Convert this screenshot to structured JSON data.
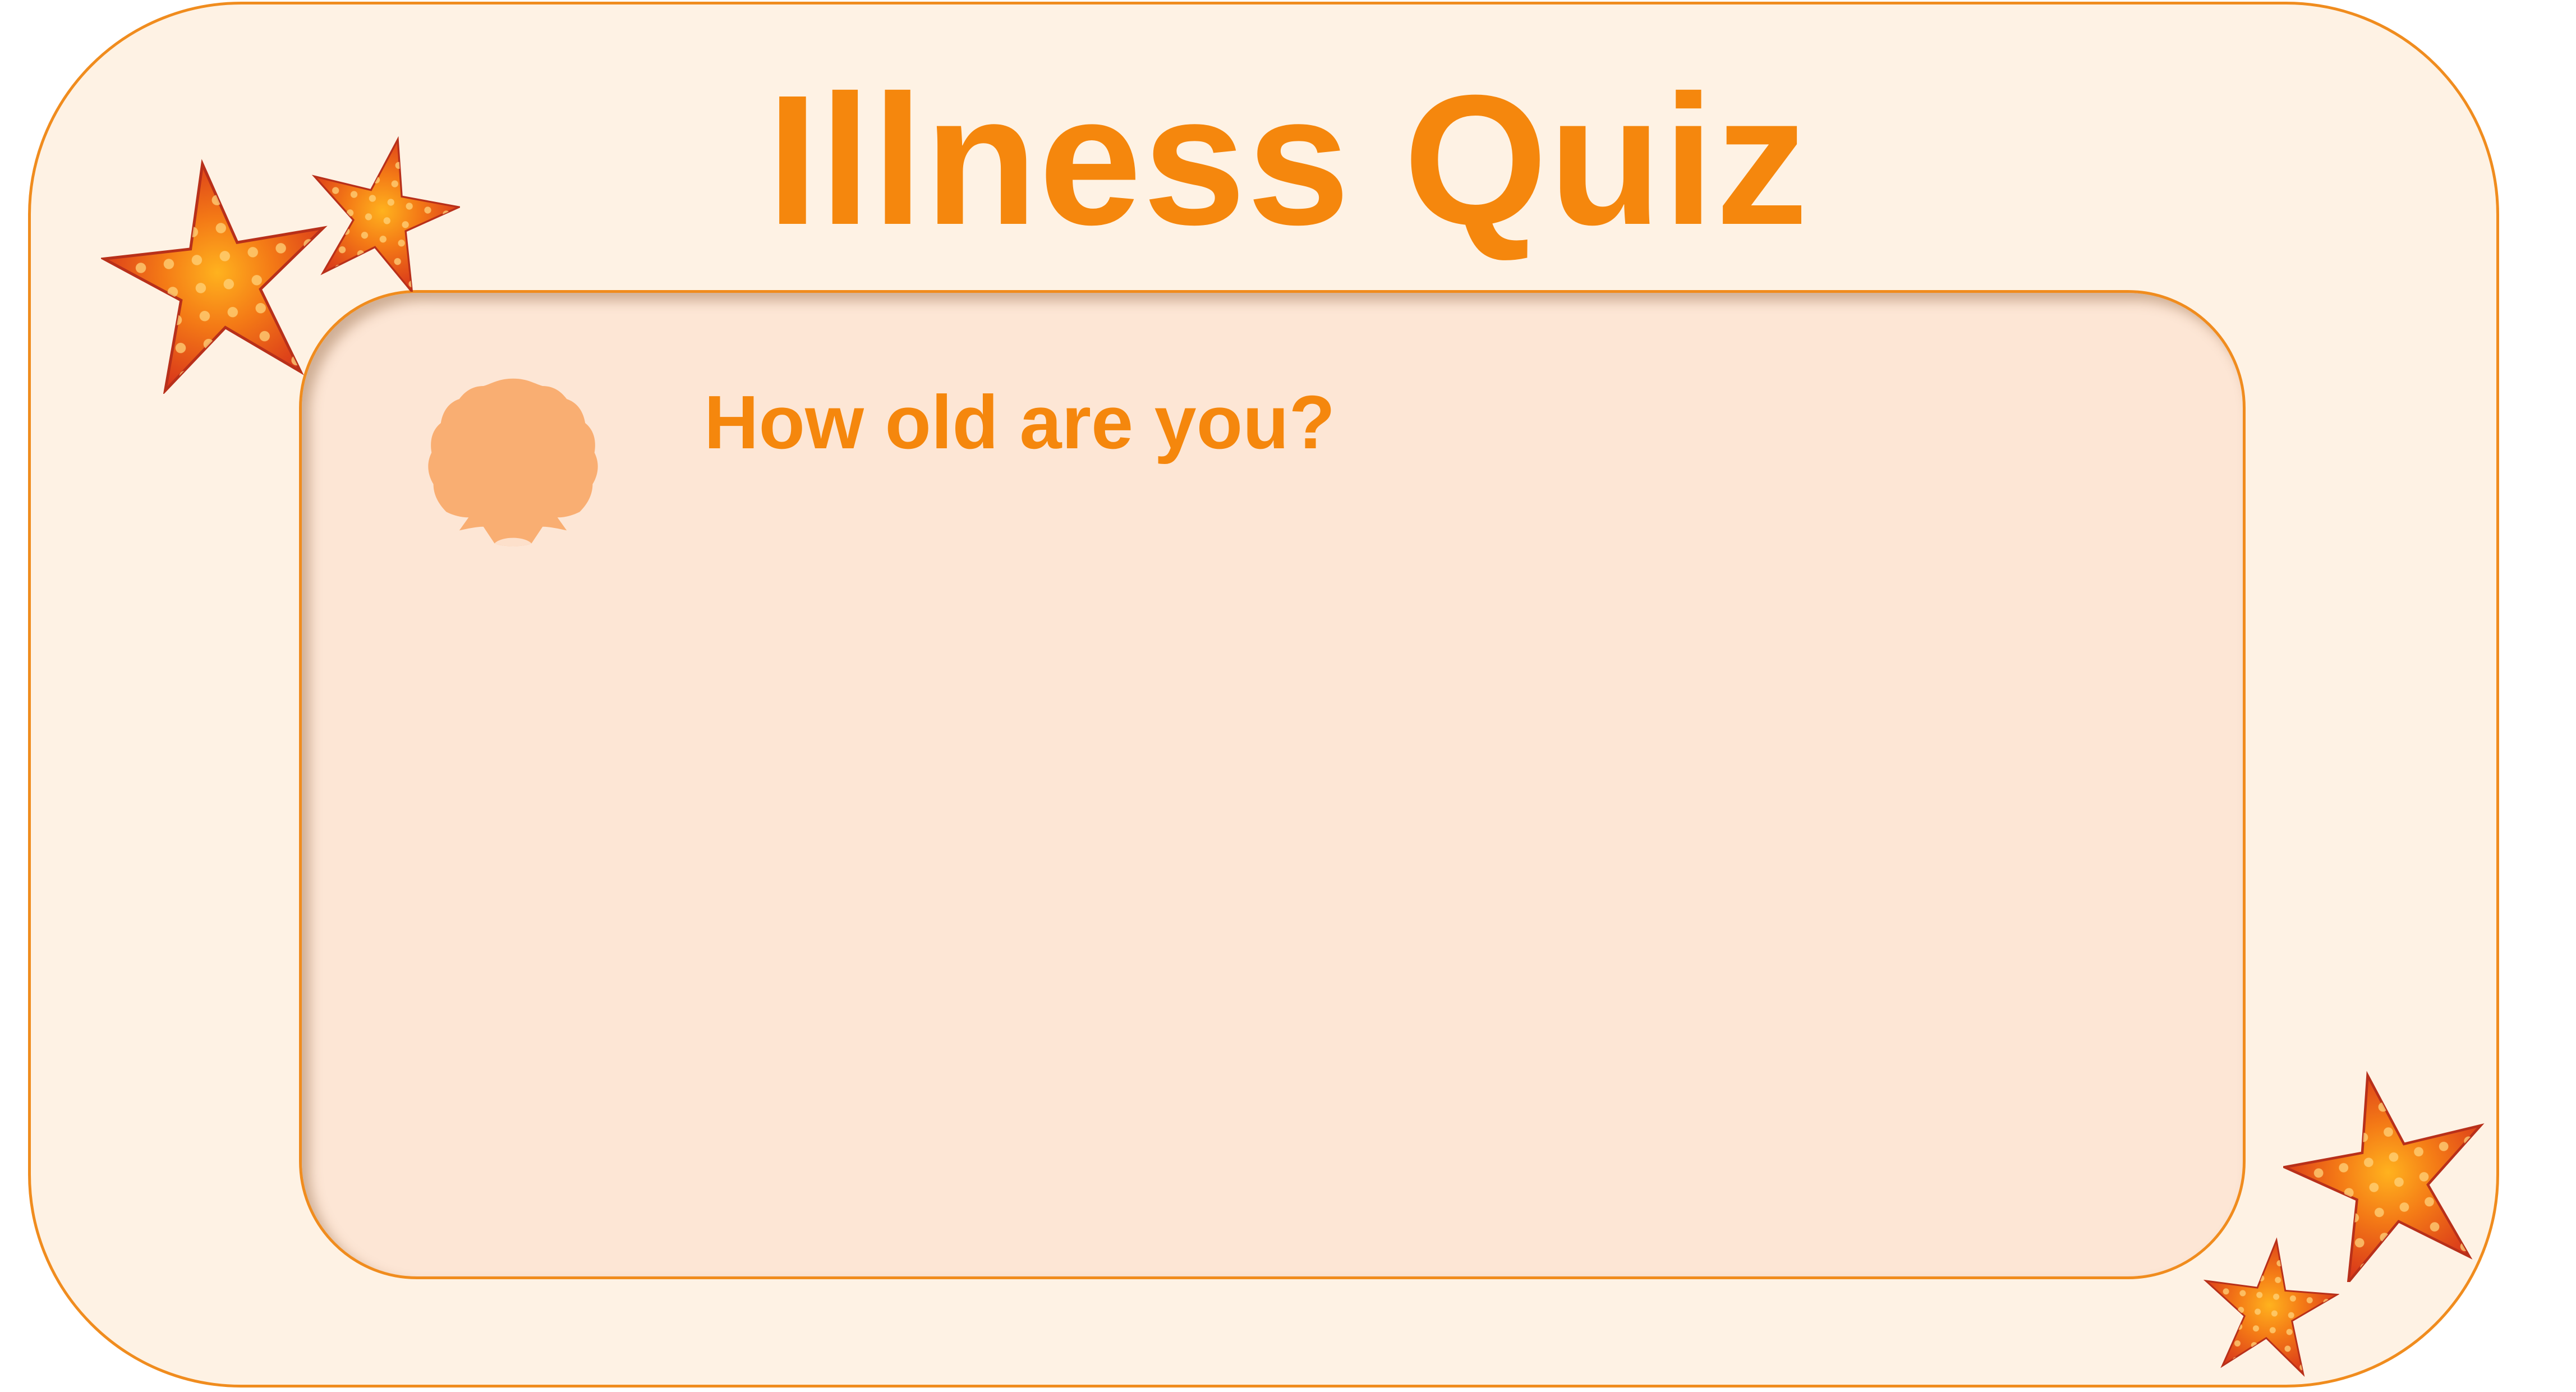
{
  "title": "Illness Quiz",
  "question": "How old are you?",
  "decorations": {
    "top_left_icons": [
      "starfish-icon",
      "starfish-icon"
    ],
    "bottom_right_icons": [
      "starfish-icon",
      "starfish-icon"
    ],
    "question_icon": "seashell-icon"
  },
  "colors": {
    "accent": "#f5870d",
    "frame_border": "#f08c1e",
    "outer_background": "#fef2e4",
    "panel_background": "#fde6d5",
    "shell": "#f9ae72",
    "starfish": "#e8501e"
  }
}
